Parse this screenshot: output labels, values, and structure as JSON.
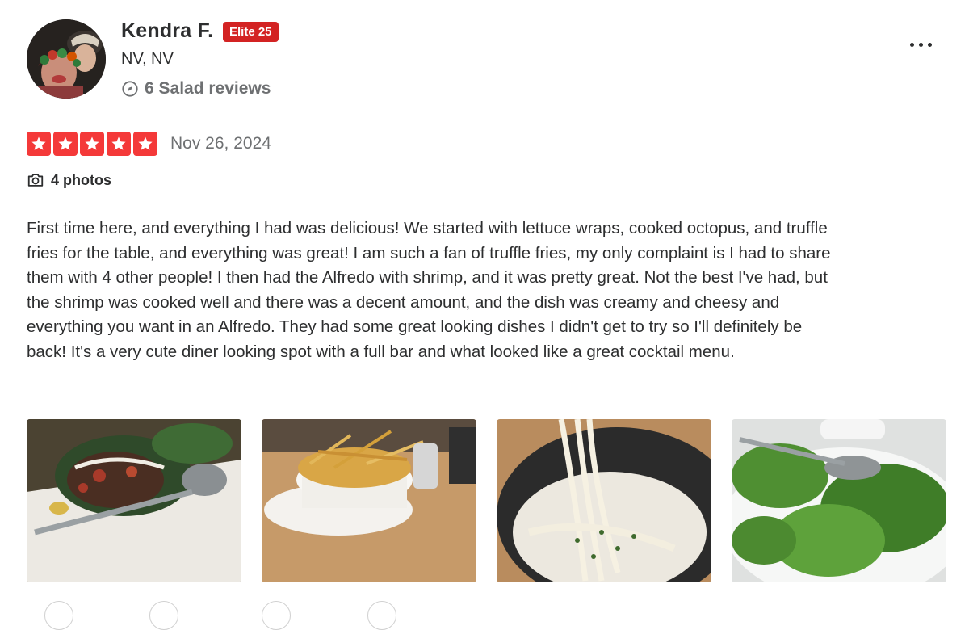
{
  "user": {
    "name": "Kendra F.",
    "elite_badge": "Elite 25",
    "location": "NV, NV",
    "reviews_stat": "6 Salad reviews",
    "reviews_icon": "compass-icon"
  },
  "review": {
    "rating": 5,
    "max_rating": 5,
    "date": "Nov 26, 2024",
    "photos_label": "4 photos",
    "text": "First time here, and everything I had was delicious! We started with lettuce wraps, cooked octopus, and truffle fries for the table, and everything was great! I am such a fan of truffle fries, my only complaint is I had to share them with 4 other people! I then had the Alfredo with shrimp, and it was pretty great. Not the best I've had, but the shrimp was cooked well and there was a decent amount, and the dish was creamy and cheesy and everything you want in an Alfredo. They had some great looking dishes I didn't get to try so I'll definitely be back! It's a very cute diner looking spot with a full bar and what looked like a great cocktail menu."
  },
  "colors": {
    "star": "#f43939",
    "elite": "#d32323",
    "text": "#2d2e2f",
    "muted": "#6e7072"
  },
  "icons": {
    "more": "more-horizontal-icon",
    "camera": "camera-icon",
    "star": "star-icon"
  }
}
